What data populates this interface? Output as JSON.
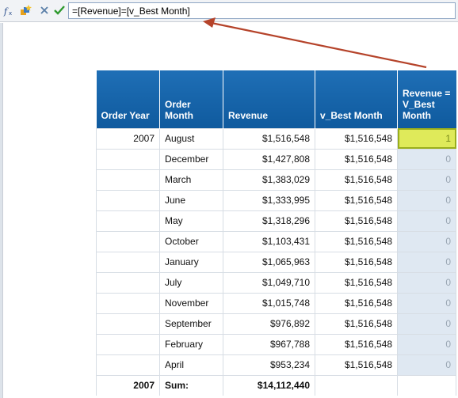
{
  "formula_bar": {
    "icons": [
      "formula-editor-icon",
      "create-variable-icon",
      "cancel-icon",
      "validate-icon"
    ],
    "formula": "=[Revenue]=[v_Best Month]"
  },
  "table": {
    "columns": [
      "Order Year",
      "Order Month",
      "Revenue",
      "v_Best Month",
      "Revenue = V_Best Month"
    ],
    "rows": [
      {
        "year": "2007",
        "month": "August",
        "revenue": "$1,516,548",
        "best": "$1,516,548",
        "flag": "1"
      },
      {
        "year": "",
        "month": "December",
        "revenue": "$1,427,808",
        "best": "$1,516,548",
        "flag": "0"
      },
      {
        "year": "",
        "month": "March",
        "revenue": "$1,383,029",
        "best": "$1,516,548",
        "flag": "0"
      },
      {
        "year": "",
        "month": "June",
        "revenue": "$1,333,995",
        "best": "$1,516,548",
        "flag": "0"
      },
      {
        "year": "",
        "month": "May",
        "revenue": "$1,318,296",
        "best": "$1,516,548",
        "flag": "0"
      },
      {
        "year": "",
        "month": "October",
        "revenue": "$1,103,431",
        "best": "$1,516,548",
        "flag": "0"
      },
      {
        "year": "",
        "month": "January",
        "revenue": "$1,065,963",
        "best": "$1,516,548",
        "flag": "0"
      },
      {
        "year": "",
        "month": "July",
        "revenue": "$1,049,710",
        "best": "$1,516,548",
        "flag": "0"
      },
      {
        "year": "",
        "month": "November",
        "revenue": "$1,015,748",
        "best": "$1,516,548",
        "flag": "0"
      },
      {
        "year": "",
        "month": "September",
        "revenue": "$976,892",
        "best": "$1,516,548",
        "flag": "0"
      },
      {
        "year": "",
        "month": "February",
        "revenue": "$967,788",
        "best": "$1,516,548",
        "flag": "0"
      },
      {
        "year": "",
        "month": "April",
        "revenue": "$953,234",
        "best": "$1,516,548",
        "flag": "0"
      }
    ],
    "footer": {
      "year": "2007",
      "label": "Sum:",
      "revenue": "$14,112,440"
    }
  },
  "colors": {
    "header_bg": "#1565ab",
    "selected_cell": "#dfea5a",
    "flag_column": "#dfe8f2",
    "annotation_arrow": "#b5432a"
  }
}
